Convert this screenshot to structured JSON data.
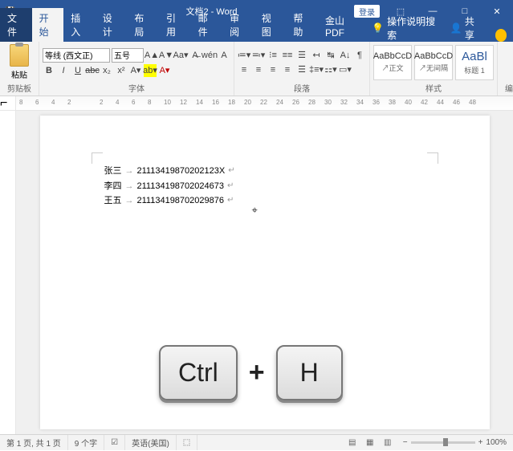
{
  "title": "文档2 - Word",
  "qat": {
    "save": "💾",
    "undo": "↶",
    "redo": "↷",
    "more": "▾"
  },
  "win": {
    "login": "登录",
    "opts": "⬚",
    "min": "—",
    "max": "□",
    "close": "✕"
  },
  "tabs": [
    "文件",
    "开始",
    "插入",
    "设计",
    "布局",
    "引用",
    "邮件",
    "审阅",
    "视图",
    "帮助",
    "金山PDF"
  ],
  "tellme": {
    "icon": "💡",
    "text": "操作说明搜索"
  },
  "share": "共享",
  "ribbon": {
    "clipboard": {
      "paste": "粘贴",
      "label": "剪贴板"
    },
    "font": {
      "name": "等线 (西文正)",
      "size": "五号",
      "row1": [
        "A▲",
        "A▼",
        "Aa▾",
        "A̶",
        "wén",
        "A"
      ],
      "row2": [
        "B",
        "I",
        "U",
        "abc",
        "x₂",
        "x²",
        "A▾",
        "ab▾",
        "A▾"
      ],
      "label": "字体"
    },
    "para": {
      "row1": [
        "≔▾",
        "≕▾",
        "⁝≡",
        "≡≡",
        "☰",
        "↤",
        "↹",
        "A↓",
        "¶"
      ],
      "row2": [
        "≡",
        "≡",
        "≡",
        "≡",
        "☰",
        "‡≡▾",
        "⚏▾",
        "▭▾"
      ],
      "label": "段落"
    },
    "styles": {
      "items": [
        {
          "prev": "AaBbCcD",
          "name": "↗正文"
        },
        {
          "prev": "AaBbCcD",
          "name": "↗无间隔"
        },
        {
          "prev": "AaBl",
          "name": "标题 1"
        }
      ],
      "label": "样式"
    },
    "editing": {
      "label": "编辑"
    }
  },
  "ruler_marks": [
    "8",
    "6",
    "4",
    "2",
    "",
    "2",
    "4",
    "6",
    "8",
    "10",
    "12",
    "14",
    "16",
    "18",
    "20",
    "22",
    "24",
    "26",
    "28",
    "30",
    "32",
    "34",
    "36",
    "38",
    "40",
    "42",
    "44",
    "46",
    "48"
  ],
  "doc": [
    {
      "name": "张三",
      "id": "21113419870202123X"
    },
    {
      "name": "李四",
      "id": "211134198702024673"
    },
    {
      "name": "王五",
      "id": "211134198702029876"
    }
  ],
  "status": {
    "page": "第 1 页, 共 1 页",
    "words": "9 个字",
    "proof": "☑",
    "lang": "英语(美国)",
    "rec": "⬚",
    "zoom_out": "−",
    "zoom_in": "+",
    "zoom": "100%"
  },
  "overlay": {
    "key1": "Ctrl",
    "plus": "+",
    "key2": "H"
  }
}
